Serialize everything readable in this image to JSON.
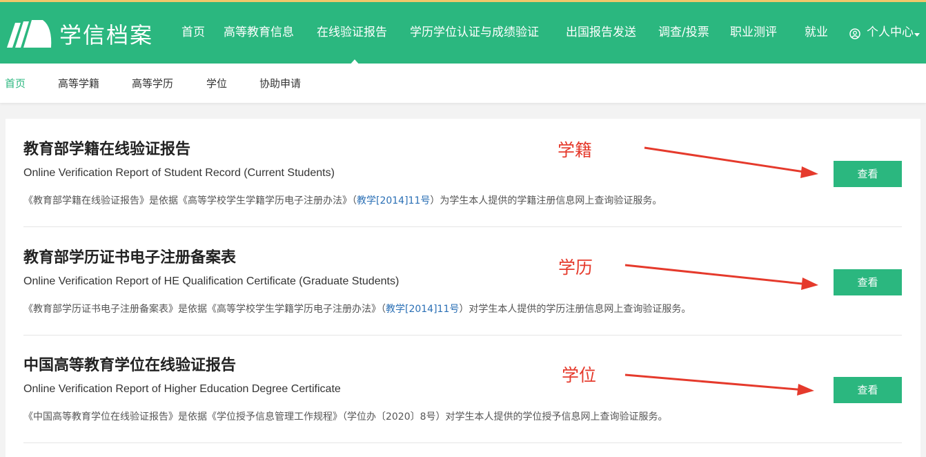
{
  "header": {
    "brand": "学信档案",
    "nav": [
      "首页",
      "高等教育信息",
      "在线验证报告",
      "学历学位认证与成绩验证",
      "出国报告发送",
      "调查/投票",
      "职业测评",
      "就业"
    ],
    "user_menu": "个人中心",
    "active_nav": "在线验证报告"
  },
  "subnav": {
    "items": [
      "首页",
      "高等学籍",
      "高等学历",
      "学位",
      "协助申请"
    ],
    "active": "首页"
  },
  "sections": [
    {
      "title": "教育部学籍在线验证报告",
      "subtitle": "Online Verification Report of Student Record (Current Students)",
      "desc_pre": "《教育部学籍在线验证报告》是依据《高等学校学生学籍学历电子注册办法》（",
      "desc_link": "教学[2014]11号",
      "desc_post": "）为学生本人提供的学籍注册信息网上查询验证服务。",
      "button": "查看",
      "annotation": "学籍"
    },
    {
      "title": "教育部学历证书电子注册备案表",
      "subtitle": "Online Verification Report of HE Qualification Certificate (Graduate Students)",
      "desc_pre": "《教育部学历证书电子注册备案表》是依据《高等学校学生学籍学历电子注册办法》（",
      "desc_link": "教学[2014]11号",
      "desc_post": "）对学生本人提供的学历注册信息网上查询验证服务。",
      "button": "查看",
      "annotation": "学历"
    },
    {
      "title": "中国高等教育学位在线验证报告",
      "subtitle": "Online Verification Report of Higher Education Degree Certificate",
      "desc_pre": "《中国高等教育学位在线验证报告》是依据《学位授予信息管理工作规程》（学位办〔2020〕8号）对学生本人提供的学位授予信息网上查询验证服务。",
      "desc_link": "",
      "desc_post": "",
      "button": "查看",
      "annotation": "学位"
    }
  ],
  "colors": {
    "brand_green": "#2bb77f",
    "annotation_red": "#e53a2c",
    "link_blue": "#2a6fb5"
  }
}
